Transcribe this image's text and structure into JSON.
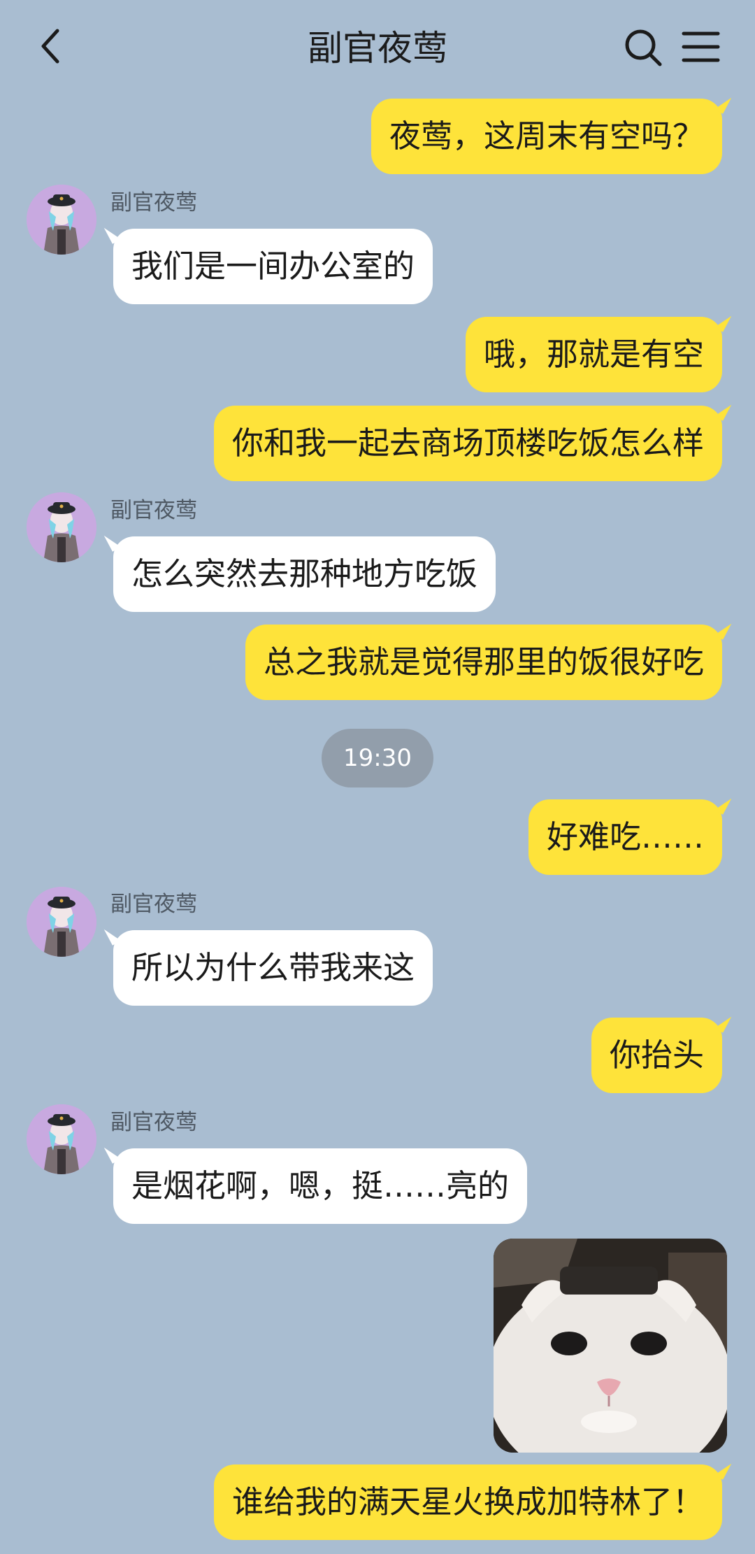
{
  "header": {
    "title": "副官夜莺"
  },
  "messages": [
    {
      "dir": "sent",
      "text": "夜莺，这周末有空吗？"
    },
    {
      "dir": "recv",
      "sender": "副官夜莺",
      "text": "我们是一间办公室的"
    },
    {
      "dir": "sent",
      "text": "哦，那就是有空"
    },
    {
      "dir": "sent",
      "text": "你和我一起去商场顶楼吃饭怎么样"
    },
    {
      "dir": "recv",
      "sender": "副官夜莺",
      "text": "怎么突然去那种地方吃饭"
    },
    {
      "dir": "sent",
      "text": "总之我就是觉得那里的饭很好吃"
    },
    {
      "dir": "time",
      "text": "19:30"
    },
    {
      "dir": "sent",
      "text": "好难吃……"
    },
    {
      "dir": "recv",
      "sender": "副官夜莺",
      "text": "所以为什么带我来这"
    },
    {
      "dir": "sent",
      "text": "你抬头"
    },
    {
      "dir": "recv",
      "sender": "副官夜莺",
      "text": "是烟花啊，嗯，挺……亮的"
    },
    {
      "dir": "sent",
      "type": "sticker",
      "sticker": "cat-face-sticker"
    },
    {
      "dir": "sent",
      "text": "谁给我的满天星火换成加特林了！"
    }
  ],
  "colors": {
    "background": "#a9bdd1",
    "sent_bubble": "#fee33a",
    "received_bubble": "#ffffff",
    "time_pill": "#929eab",
    "avatar_bg": "#c8a9e0"
  },
  "icons": {
    "back": "chevron-left-icon",
    "search": "search-icon",
    "menu": "menu-icon"
  }
}
